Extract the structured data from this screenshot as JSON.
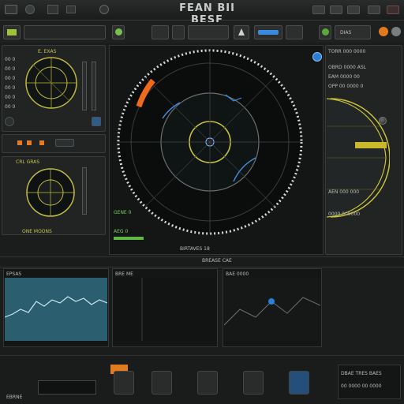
{
  "window": {
    "title": "FEAN BII BESF",
    "controls": [
      "minimize-icon",
      "maximize-icon",
      "close-icon"
    ]
  },
  "toolbar": {
    "tabs": [
      "",
      "",
      "",
      ""
    ],
    "right_label": "DIAS"
  },
  "left_top": {
    "title": "E. EXAS",
    "labels": [
      "00 0",
      "00 0",
      "00 0",
      "00 0",
      "00 0",
      "00 0"
    ]
  },
  "left_mid": {
    "title": "CRL GRAS",
    "footer": "ONE MOONS"
  },
  "radar": {
    "bottom_label": "BIRTAVES 18",
    "legend": [
      "GENE 0",
      "AEG 0"
    ],
    "accent": "#f06a1c",
    "ring_color": "#c8c13a"
  },
  "right_panel": {
    "header": "TORR 000 0000",
    "items": [
      "OBRD 0000 ASL",
      "EAM 0000 00",
      "OPP 00 0000 0",
      "AEN 000 000",
      "0000 000000"
    ]
  },
  "strip": {
    "label": "BREASE CAE"
  },
  "charts": [
    {
      "name": "chart-1",
      "title": "EPSAS"
    },
    {
      "name": "chart-2",
      "title": "BRE ME"
    },
    {
      "name": "chart-3",
      "title": "BAE 0000"
    }
  ],
  "bottom": {
    "left_label": "EBRNE",
    "right_label": "DBAE TRES BAES",
    "right_sub": "00 0000 00 0000"
  }
}
